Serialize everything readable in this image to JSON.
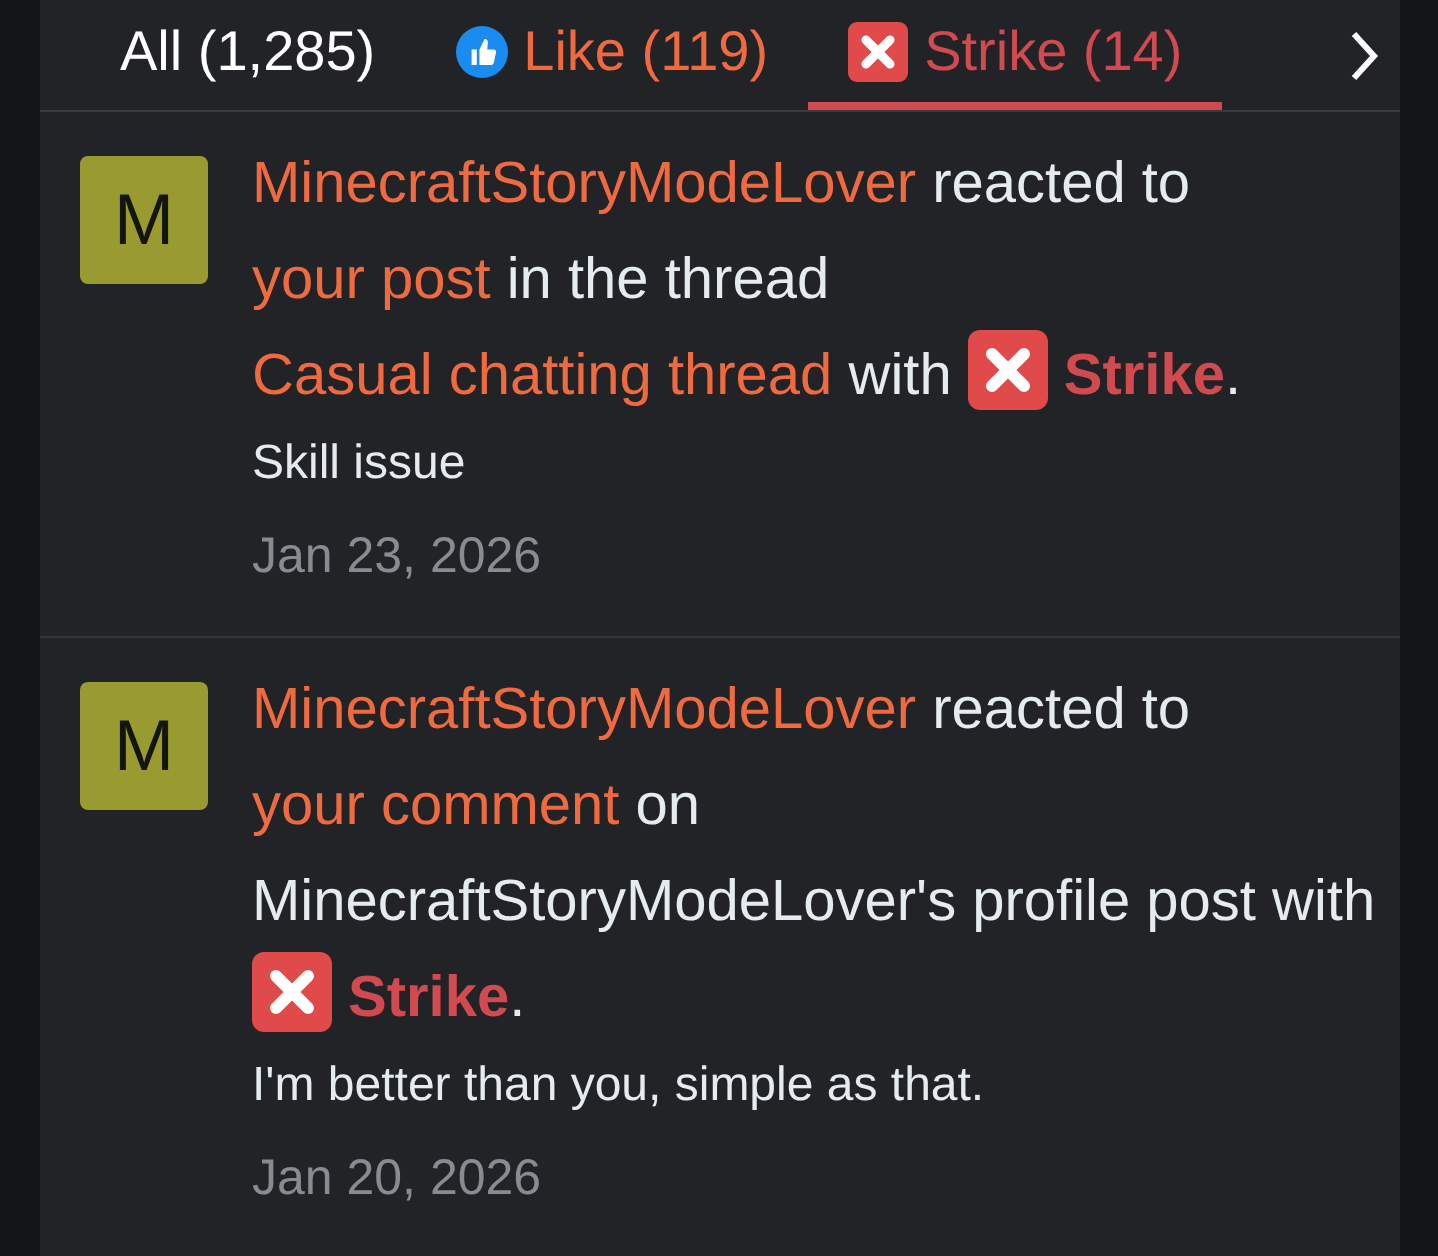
{
  "tabs": [
    {
      "label": "All (1,285)",
      "kind": "all",
      "selected": false
    },
    {
      "label": "Like (119)",
      "kind": "like",
      "selected": false
    },
    {
      "label": "Strike (14)",
      "kind": "strike",
      "selected": true
    }
  ],
  "alerts": [
    {
      "avatar": "M",
      "parts": [
        {
          "kind": "link",
          "text": "MinecraftStoryModeLover"
        },
        {
          "kind": "text",
          "text": "reacted to"
        },
        {
          "kind": "link",
          "text": "your post"
        },
        {
          "kind": "text",
          "text": "in the thread"
        },
        {
          "kind": "link",
          "text": "Casual chatting thread"
        },
        {
          "kind": "text",
          "text": "with"
        },
        {
          "kind": "reaction",
          "text": "Strike"
        },
        {
          "kind": "text",
          "text": "."
        }
      ],
      "message": "Skill issue",
      "date": "Jan 23, 2026"
    },
    {
      "avatar": "M",
      "parts": [
        {
          "kind": "link",
          "text": "MinecraftStoryModeLover"
        },
        {
          "kind": "text",
          "text": "reacted to"
        },
        {
          "kind": "link",
          "text": "your comment"
        },
        {
          "kind": "text",
          "text": "on MinecraftStoryModeLover's profile post with"
        },
        {
          "kind": "reaction",
          "text": "Strike"
        },
        {
          "kind": "text",
          "text": "."
        }
      ],
      "message": "I'm better than you, simple as that.",
      "date": "Jan 20, 2026"
    }
  ]
}
